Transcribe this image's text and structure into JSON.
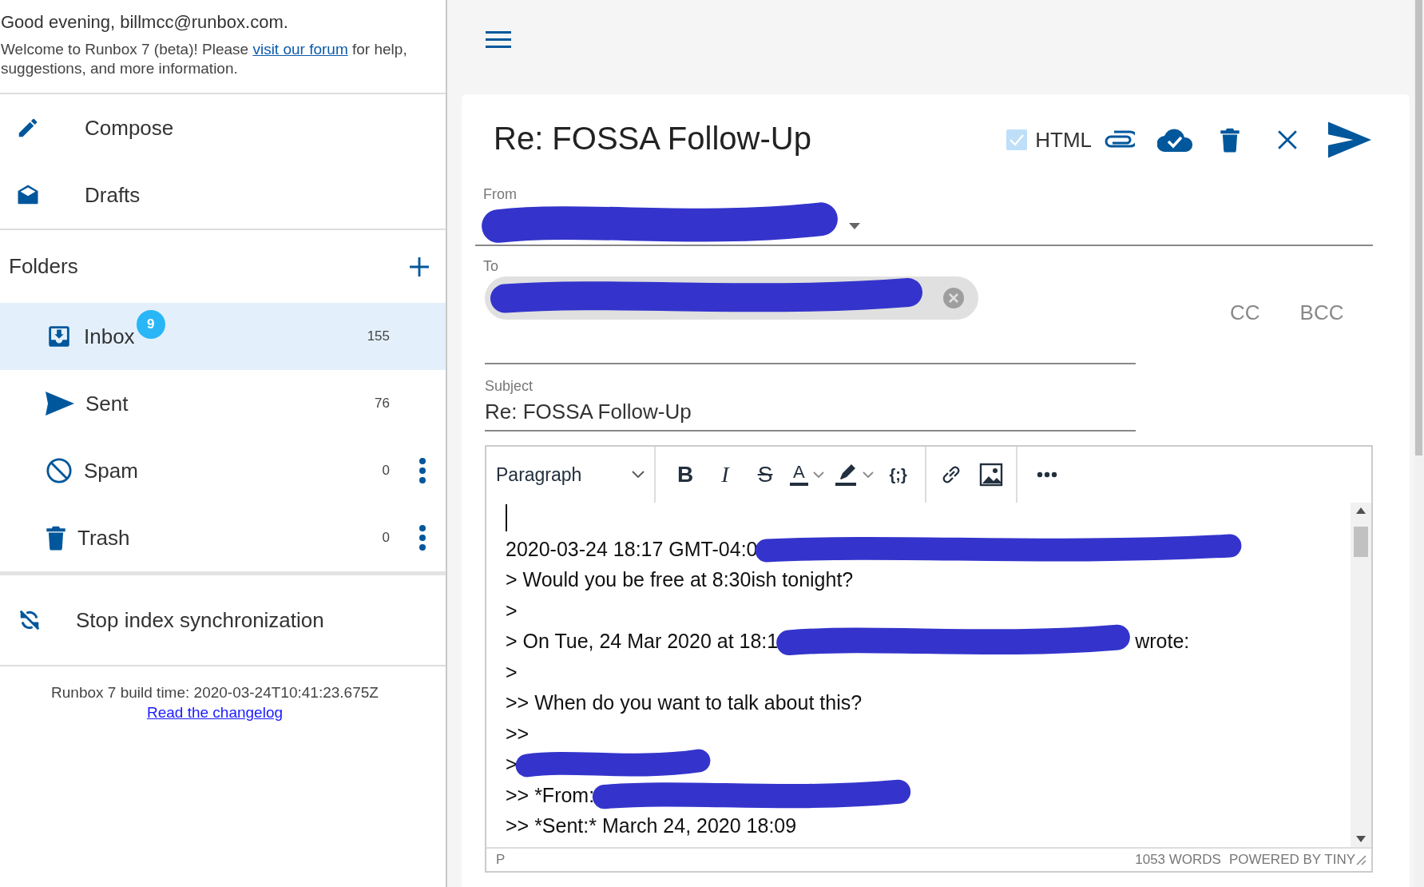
{
  "sidebar": {
    "greeting": "Good evening, billmcc@runbox.com.",
    "welcome": {
      "before": "Welcome to Runbox 7 (beta)! Please ",
      "link": "visit our forum",
      "after": " for help, suggestions, and more information."
    },
    "actions": [
      {
        "kind": "compose",
        "label": "Compose"
      },
      {
        "kind": "drafts",
        "label": "Drafts"
      }
    ],
    "folders_heading": "Folders",
    "folders": [
      {
        "kind": "inbox",
        "label": "Inbox",
        "badge": "9",
        "count": "155",
        "selected": true,
        "menu": false
      },
      {
        "kind": "sent",
        "label": "Sent",
        "count": "76",
        "selected": false,
        "menu": false
      },
      {
        "kind": "spam",
        "label": "Spam",
        "count": "0",
        "selected": false,
        "menu": true
      },
      {
        "kind": "trash",
        "label": "Trash",
        "count": "0",
        "selected": false,
        "menu": true
      }
    ],
    "sync_action": "Stop index synchronization",
    "build_info": "Runbox 7 build time: 2020-03-24T10:41:23.675Z",
    "changelog_link": "Read the changelog"
  },
  "composer": {
    "title": "Re: FOSSA Follow-Up",
    "html_toggle": {
      "label": "HTML",
      "checked": true
    },
    "from": {
      "label": "From",
      "redacted": true
    },
    "to": {
      "label": "To",
      "redacted": true
    },
    "cc": "CC",
    "bcc": "BCC",
    "subject": {
      "label": "Subject",
      "value": "Re: FOSSA Follow-Up"
    },
    "editor": {
      "block_format": "Paragraph",
      "toolbar": [
        {
          "kind": "bold",
          "glyph": "B"
        },
        {
          "kind": "italic",
          "glyph": "I"
        },
        {
          "kind": "strike",
          "glyph": "S"
        },
        {
          "kind": "text-color",
          "glyph": "A"
        },
        {
          "kind": "highlight"
        },
        {
          "kind": "code",
          "glyph": "{;}"
        },
        {
          "kind": "link"
        },
        {
          "kind": "image"
        },
        {
          "kind": "more"
        }
      ],
      "lines": [
        {
          "kind": "caret"
        },
        {
          "kind": "text",
          "text": "2020-03-24 18:17 GMT-04:0",
          "redacted": true
        },
        {
          "kind": "text",
          "text": "> Would you be free at 8:30ish tonight?"
        },
        {
          "kind": "text",
          "text": ">"
        },
        {
          "kind": "text",
          "text": "> On Tue, 24 Mar 2020 at 18:1",
          "redacted": true,
          "after": "wrote:"
        },
        {
          "kind": "text",
          "text": ">"
        },
        {
          "kind": "text",
          "text": ">> When do you want to talk about this?"
        },
        {
          "kind": "text",
          "text": ">>"
        },
        {
          "kind": "text",
          "text": ">",
          "redacted": true
        },
        {
          "kind": "text",
          "text": ">> *From:",
          "redacted": true
        },
        {
          "kind": "text",
          "text": ">> *Sent:* March 24, 2020 18:09"
        }
      ],
      "status_path": "P",
      "word_count": "1053 WORDS",
      "branding": "POWERED BY TINY"
    }
  }
}
